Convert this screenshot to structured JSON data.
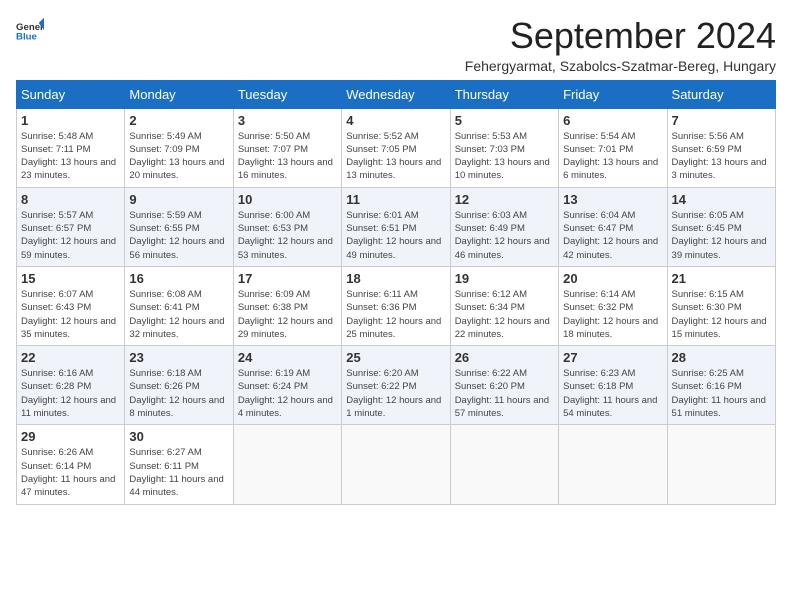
{
  "logo": {
    "general": "General",
    "blue": "Blue"
  },
  "header": {
    "month": "September 2024",
    "location": "Fehergyarmat, Szabolcs-Szatmar-Bereg, Hungary"
  },
  "weekdays": [
    "Sunday",
    "Monday",
    "Tuesday",
    "Wednesday",
    "Thursday",
    "Friday",
    "Saturday"
  ],
  "weeks": [
    [
      {
        "day": 1,
        "info": "Sunrise: 5:48 AM\nSunset: 7:11 PM\nDaylight: 13 hours and 23 minutes."
      },
      {
        "day": 2,
        "info": "Sunrise: 5:49 AM\nSunset: 7:09 PM\nDaylight: 13 hours and 20 minutes."
      },
      {
        "day": 3,
        "info": "Sunrise: 5:50 AM\nSunset: 7:07 PM\nDaylight: 13 hours and 16 minutes."
      },
      {
        "day": 4,
        "info": "Sunrise: 5:52 AM\nSunset: 7:05 PM\nDaylight: 13 hours and 13 minutes."
      },
      {
        "day": 5,
        "info": "Sunrise: 5:53 AM\nSunset: 7:03 PM\nDaylight: 13 hours and 10 minutes."
      },
      {
        "day": 6,
        "info": "Sunrise: 5:54 AM\nSunset: 7:01 PM\nDaylight: 13 hours and 6 minutes."
      },
      {
        "day": 7,
        "info": "Sunrise: 5:56 AM\nSunset: 6:59 PM\nDaylight: 13 hours and 3 minutes."
      }
    ],
    [
      {
        "day": 8,
        "info": "Sunrise: 5:57 AM\nSunset: 6:57 PM\nDaylight: 12 hours and 59 minutes."
      },
      {
        "day": 9,
        "info": "Sunrise: 5:59 AM\nSunset: 6:55 PM\nDaylight: 12 hours and 56 minutes."
      },
      {
        "day": 10,
        "info": "Sunrise: 6:00 AM\nSunset: 6:53 PM\nDaylight: 12 hours and 53 minutes."
      },
      {
        "day": 11,
        "info": "Sunrise: 6:01 AM\nSunset: 6:51 PM\nDaylight: 12 hours and 49 minutes."
      },
      {
        "day": 12,
        "info": "Sunrise: 6:03 AM\nSunset: 6:49 PM\nDaylight: 12 hours and 46 minutes."
      },
      {
        "day": 13,
        "info": "Sunrise: 6:04 AM\nSunset: 6:47 PM\nDaylight: 12 hours and 42 minutes."
      },
      {
        "day": 14,
        "info": "Sunrise: 6:05 AM\nSunset: 6:45 PM\nDaylight: 12 hours and 39 minutes."
      }
    ],
    [
      {
        "day": 15,
        "info": "Sunrise: 6:07 AM\nSunset: 6:43 PM\nDaylight: 12 hours and 35 minutes."
      },
      {
        "day": 16,
        "info": "Sunrise: 6:08 AM\nSunset: 6:41 PM\nDaylight: 12 hours and 32 minutes."
      },
      {
        "day": 17,
        "info": "Sunrise: 6:09 AM\nSunset: 6:38 PM\nDaylight: 12 hours and 29 minutes."
      },
      {
        "day": 18,
        "info": "Sunrise: 6:11 AM\nSunset: 6:36 PM\nDaylight: 12 hours and 25 minutes."
      },
      {
        "day": 19,
        "info": "Sunrise: 6:12 AM\nSunset: 6:34 PM\nDaylight: 12 hours and 22 minutes."
      },
      {
        "day": 20,
        "info": "Sunrise: 6:14 AM\nSunset: 6:32 PM\nDaylight: 12 hours and 18 minutes."
      },
      {
        "day": 21,
        "info": "Sunrise: 6:15 AM\nSunset: 6:30 PM\nDaylight: 12 hours and 15 minutes."
      }
    ],
    [
      {
        "day": 22,
        "info": "Sunrise: 6:16 AM\nSunset: 6:28 PM\nDaylight: 12 hours and 11 minutes."
      },
      {
        "day": 23,
        "info": "Sunrise: 6:18 AM\nSunset: 6:26 PM\nDaylight: 12 hours and 8 minutes."
      },
      {
        "day": 24,
        "info": "Sunrise: 6:19 AM\nSunset: 6:24 PM\nDaylight: 12 hours and 4 minutes."
      },
      {
        "day": 25,
        "info": "Sunrise: 6:20 AM\nSunset: 6:22 PM\nDaylight: 12 hours and 1 minute."
      },
      {
        "day": 26,
        "info": "Sunrise: 6:22 AM\nSunset: 6:20 PM\nDaylight: 11 hours and 57 minutes."
      },
      {
        "day": 27,
        "info": "Sunrise: 6:23 AM\nSunset: 6:18 PM\nDaylight: 11 hours and 54 minutes."
      },
      {
        "day": 28,
        "info": "Sunrise: 6:25 AM\nSunset: 6:16 PM\nDaylight: 11 hours and 51 minutes."
      }
    ],
    [
      {
        "day": 29,
        "info": "Sunrise: 6:26 AM\nSunset: 6:14 PM\nDaylight: 11 hours and 47 minutes."
      },
      {
        "day": 30,
        "info": "Sunrise: 6:27 AM\nSunset: 6:11 PM\nDaylight: 11 hours and 44 minutes."
      },
      null,
      null,
      null,
      null,
      null
    ]
  ]
}
